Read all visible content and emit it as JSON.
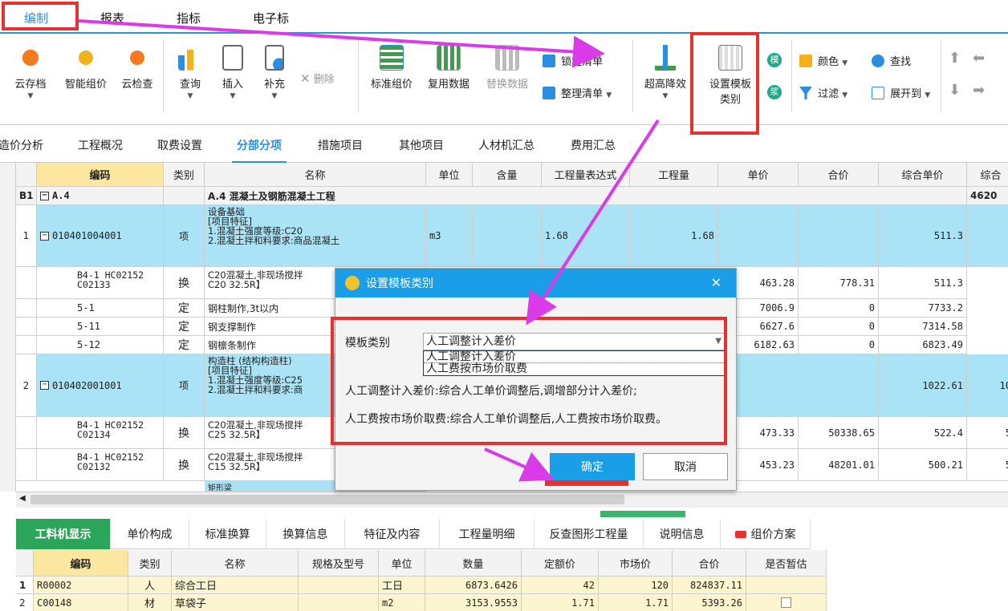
{
  "menubar": {
    "tabs": [
      "编制",
      "报表",
      "指标",
      "电子标"
    ]
  },
  "ribbon": {
    "buttons": [
      "云存档",
      "智能组价",
      "云检查",
      "查询",
      "插入",
      "补充",
      "标准组价",
      "复用数据",
      "替换数据",
      "超高降效"
    ],
    "delete_label": "删除",
    "lock_label": "锁定清单",
    "organize_label": "整理清单",
    "template_label_1": "设置模板",
    "template_label_2": "类别",
    "color_label": "颜色",
    "filter_label": "过滤",
    "find_label": "查找",
    "expand_label": "展开到",
    "mo_glyph": "模",
    "jiang_glyph": "浆"
  },
  "tabs2": [
    "造价分析",
    "工程概况",
    "取费设置",
    "分部分项",
    "措施项目",
    "其他项目",
    "人材机汇总",
    "费用汇总"
  ],
  "grid": {
    "headers": [
      "编码",
      "类别",
      "名称",
      "单位",
      "含量",
      "工程量表达式",
      "工程量",
      "单价",
      "合价",
      "综合单价",
      "综合"
    ],
    "section": {
      "idx": "B1",
      "code": "A.4",
      "name": "A.4  混凝土及钢筋混凝土工程",
      "total": "4620"
    },
    "row1": {
      "idx": "1",
      "code": "010401004001",
      "type": "项",
      "name_lines": [
        "设备基础",
        "[项目特征]",
        "1.混凝土强度等级:C20",
        "2.混凝土拌和料要求:商品混凝土"
      ],
      "unit": "m3",
      "expr": "1.68",
      "qty": "1.68",
      "uprice": "511.3"
    },
    "sub1": [
      {
        "code1": "B4-1 HC02152",
        "code2": "C02133",
        "type": "换",
        "name1": "C20混凝土,非现场搅拌",
        "name2": "C20 32.5R】",
        "price": "463.28",
        "total": "778.31",
        "uprice": "511.3"
      },
      {
        "code1": "5-1",
        "type": "定",
        "name1": "钢柱制作,3t以内",
        "price": "7006.9",
        "total": "0",
        "uprice": "7733.2"
      },
      {
        "code1": "5-11",
        "type": "定",
        "name1": "钢支撑制作",
        "price": "6627.6",
        "total": "0",
        "uprice": "7314.58"
      },
      {
        "code1": "5-12",
        "type": "定",
        "name1": "钢檩条制作",
        "price": "6182.63",
        "total": "0",
        "uprice": "6823.49"
      }
    ],
    "row2": {
      "idx": "2",
      "code": "010402001001",
      "type": "项",
      "name_lines": [
        "构造柱 (结构构造柱)",
        "[项目特征]",
        "1.混凝土强度等级:C25",
        "2.混凝土拌和料要求:商"
      ],
      "uprice": "1022.61",
      "tail": "10"
    },
    "sub2": [
      {
        "code1": "B4-1 HC02152",
        "code2": "C02134",
        "type": "换",
        "name1": "C20混凝土,非现场搅拌",
        "name2": "C25 32.5R】",
        "price": "473.33",
        "total": "50338.65",
        "uprice": "522.4",
        "tail": "5"
      },
      {
        "code1": "B4-1 HC02152",
        "code2": "C02132",
        "type": "换",
        "name1": "C20混凝土,非现场搅拌",
        "name2": "C15 32.5R】",
        "price": "453.23",
        "total": "48201.01",
        "uprice": "500.21",
        "tail": "5"
      }
    ],
    "partial": "矩形梁"
  },
  "bottomtabs": [
    "工料机显示",
    "单价构成",
    "标准换算",
    "换算信息",
    "特征及内容",
    "工程量明细",
    "反查图形工程量",
    "说明信息",
    "组价方案"
  ],
  "bgrid": {
    "headers": [
      "编码",
      "类别",
      "名称",
      "规格及型号",
      "单位",
      "数量",
      "定额价",
      "市场价",
      "合价",
      "是否暂估"
    ],
    "rows": [
      {
        "idx": "1",
        "code": "R00002",
        "type": "人",
        "name": "综合工日",
        "unit": "工日",
        "qty": "6873.6426",
        "price": "42",
        "market": "120",
        "total": "824837.11"
      },
      {
        "idx": "2",
        "code": "C00148",
        "type": "材",
        "name": "草袋子",
        "unit": "m2",
        "qty": "3153.9553",
        "price": "1.71",
        "market": "1.71",
        "total": "5393.26"
      }
    ]
  },
  "dialog": {
    "title": "设置模板类别",
    "close": "✕",
    "field_label": "模板类别",
    "selected": "人工调整计入差价",
    "options": [
      "人工调整计入差价",
      "人工费按市场价取费"
    ],
    "desc1": "人工调整计入差价:综合人工单价调整后,调增部分计入差价;",
    "desc2": "人工费按市场价取费:综合人工单价调整后,人工费按市场价取费。",
    "ok": "确定",
    "cancel": "取消"
  },
  "colors": {
    "accent": "#1a9ee8",
    "highlight": "#e8312e",
    "arrow": "#d93be8",
    "row_blue": "#a9e3f5",
    "header_gold": "#fbe7a0"
  }
}
